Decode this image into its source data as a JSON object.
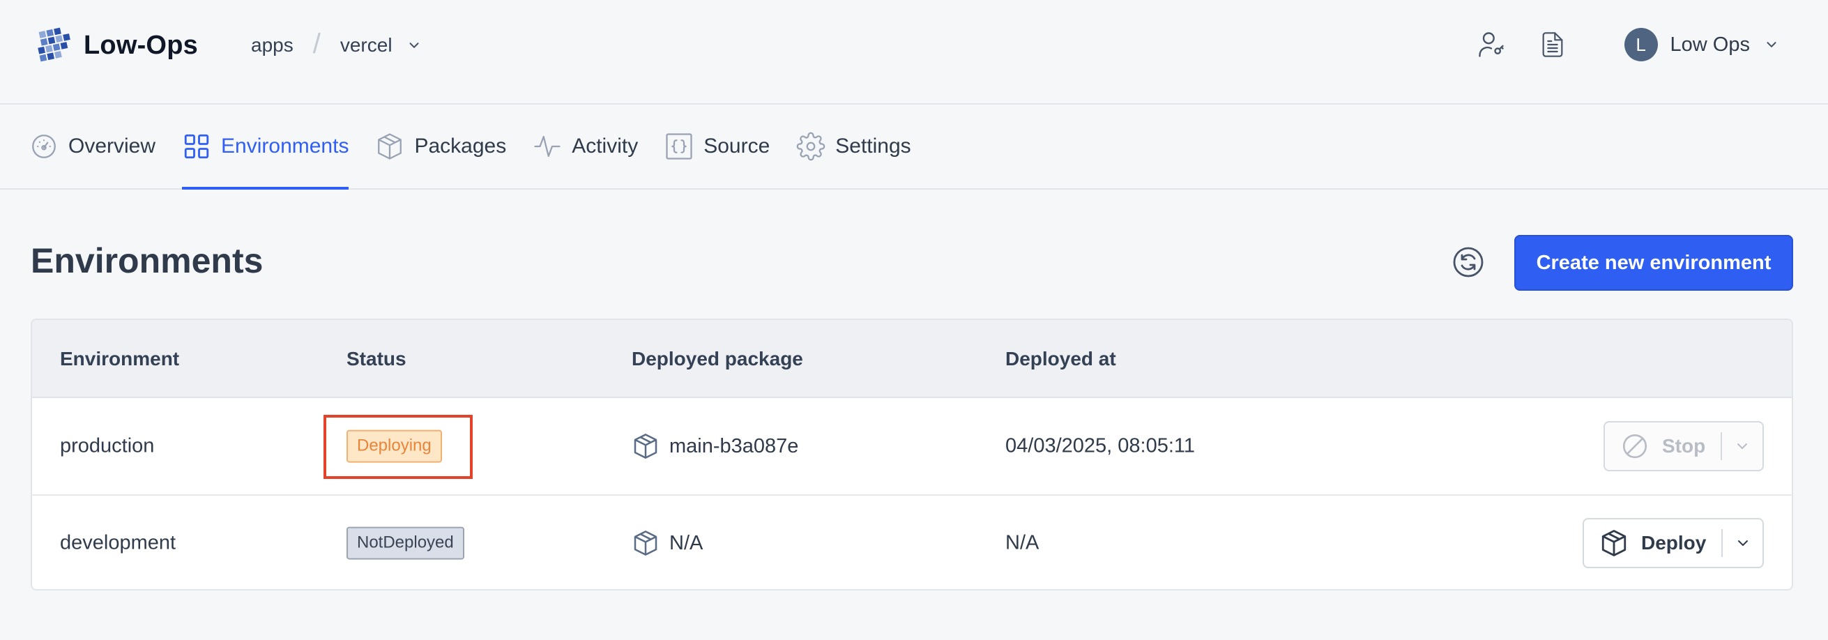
{
  "app": {
    "name": "Low-Ops"
  },
  "breadcrumb": {
    "first": "apps",
    "separator": "/",
    "second": "vercel"
  },
  "user": {
    "initial": "L",
    "name": "Low Ops"
  },
  "tabs": [
    {
      "label": "Overview",
      "icon": "gauge-icon"
    },
    {
      "label": "Environments",
      "icon": "grid-icon",
      "active": true
    },
    {
      "label": "Packages",
      "icon": "package-icon"
    },
    {
      "label": "Activity",
      "icon": "activity-icon"
    },
    {
      "label": "Source",
      "icon": "code-braces-icon"
    },
    {
      "label": "Settings",
      "icon": "gear-icon"
    }
  ],
  "page": {
    "title": "Environments",
    "create_button": "Create new environment"
  },
  "table": {
    "headers": [
      "Environment",
      "Status",
      "Deployed package",
      "Deployed at"
    ],
    "rows": [
      {
        "environment": "production",
        "status": "Deploying",
        "package": "main-b3a087e",
        "deployed_at": "04/03/2025, 08:05:11",
        "action": "Stop"
      },
      {
        "environment": "development",
        "status": "NotDeployed",
        "package": "N/A",
        "deployed_at": "N/A",
        "action": "Deploy"
      }
    ]
  },
  "colors": {
    "accent": "#2f5ff5",
    "deploying_badge": "#fde7c7",
    "notdeployed_badge": "#d9dee8",
    "highlight": "#e3432a"
  }
}
